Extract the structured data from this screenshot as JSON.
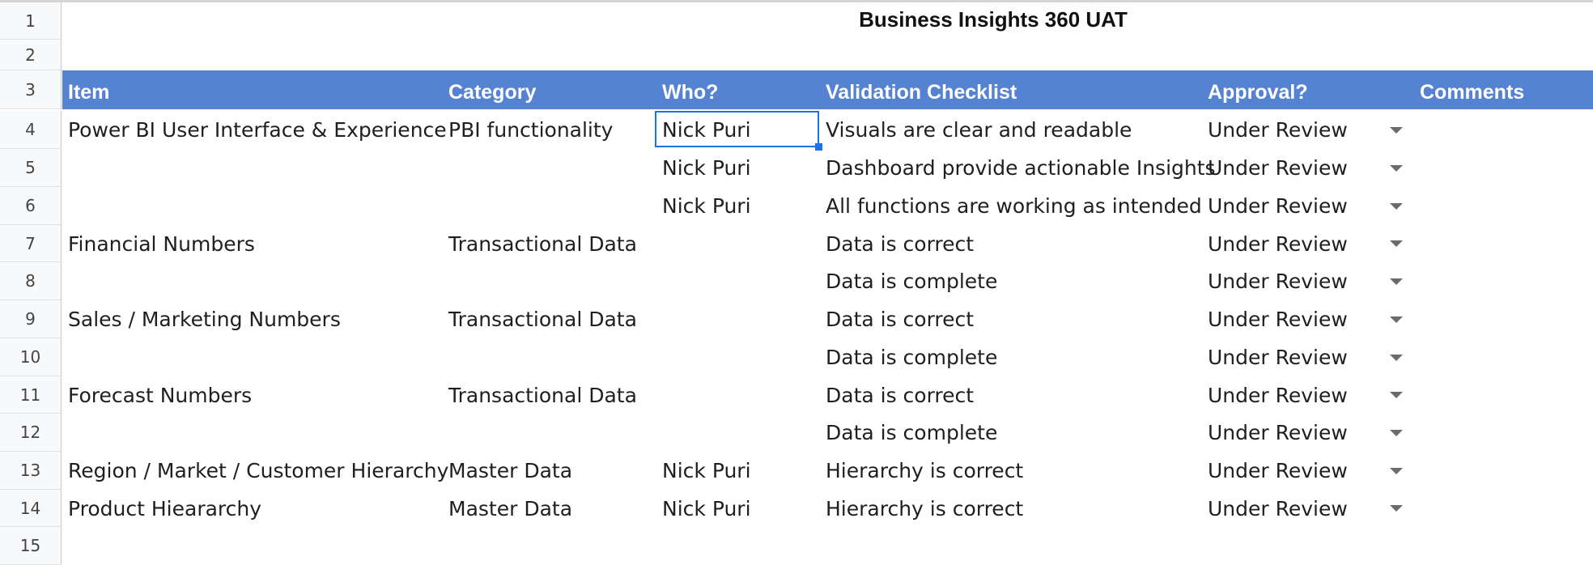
{
  "sheet": {
    "title": "Business Insights 360 UAT",
    "row_numbers": [
      "1",
      "2",
      "3",
      "4",
      "5",
      "6",
      "7",
      "8",
      "9",
      "10",
      "11",
      "12",
      "13",
      "14",
      "15"
    ],
    "headers": {
      "item": "Item",
      "category": "Category",
      "who": "Who?",
      "checklist": "Validation Checklist",
      "approval": "Approval?",
      "comments": "Comments"
    },
    "rows": [
      {
        "item": "Power BI User Interface & Experience",
        "category": "PBI functionality",
        "who": "Nick Puri",
        "checklist": "Visuals are clear and readable",
        "approval": "Under Review"
      },
      {
        "item": "",
        "category": "",
        "who": "Nick Puri",
        "checklist": "Dashboard provide actionable Insights",
        "approval": "Under Review"
      },
      {
        "item": "",
        "category": "",
        "who": "Nick Puri",
        "checklist": "All functions are working as intended",
        "approval": "Under Review"
      },
      {
        "item": "Financial Numbers",
        "category": "Transactional Data",
        "who": "",
        "checklist": "Data is correct",
        "approval": "Under Review"
      },
      {
        "item": "",
        "category": "",
        "who": "",
        "checklist": "Data is complete",
        "approval": "Under Review"
      },
      {
        "item": "Sales / Marketing Numbers",
        "category": "Transactional Data",
        "who": "",
        "checklist": "Data is correct",
        "approval": "Under Review"
      },
      {
        "item": "",
        "category": "",
        "who": "",
        "checklist": "Data is complete",
        "approval": "Under Review"
      },
      {
        "item": "Forecast Numbers",
        "category": "Transactional Data",
        "who": "",
        "checklist": "Data is correct",
        "approval": "Under Review"
      },
      {
        "item": "",
        "category": "",
        "who": "",
        "checklist": "Data is complete",
        "approval": "Under Review"
      },
      {
        "item": "Region / Market / Customer Hierarchy",
        "category": "Master Data",
        "who": "Nick Puri",
        "checklist": "Hierarchy is correct",
        "approval": "Under Review"
      },
      {
        "item": "Product Hieararchy",
        "category": "Master Data",
        "who": "Nick Puri",
        "checklist": "Hierarchy is correct",
        "approval": "Under Review"
      }
    ]
  },
  "colors": {
    "header_bg": "#5582d1",
    "selection": "#1a73e8"
  },
  "icons": {
    "dropdown": "chevron-down-icon"
  }
}
